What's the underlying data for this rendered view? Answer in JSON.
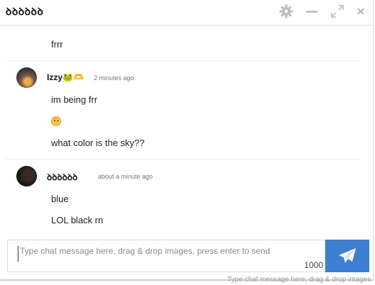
{
  "header": {
    "title": "ꝺꝺꝺꝺꝺꝺ",
    "icons": [
      "gear-icon",
      "minimize-icon",
      "expand-icon",
      "close-icon"
    ]
  },
  "messages": {
    "first_text": "frrr",
    "groups": [
      {
        "author": "Izzy🐸🫶",
        "time": "2 minutes ago",
        "lines": [
          "im being frr",
          "😉",
          "what color is the sky??"
        ]
      },
      {
        "author": "ꝺꝺꝺꝺꝺꝺ",
        "time": "about a minute ago",
        "lines": [
          "blue",
          "LOL black rn"
        ]
      }
    ]
  },
  "composer": {
    "placeholder": "Type chat message here, drag & drop images, press enter to send",
    "counter": "1000"
  },
  "background_text": "Type chat message here, drag & drop images",
  "colors": {
    "send_button": "#3d7fd0"
  }
}
